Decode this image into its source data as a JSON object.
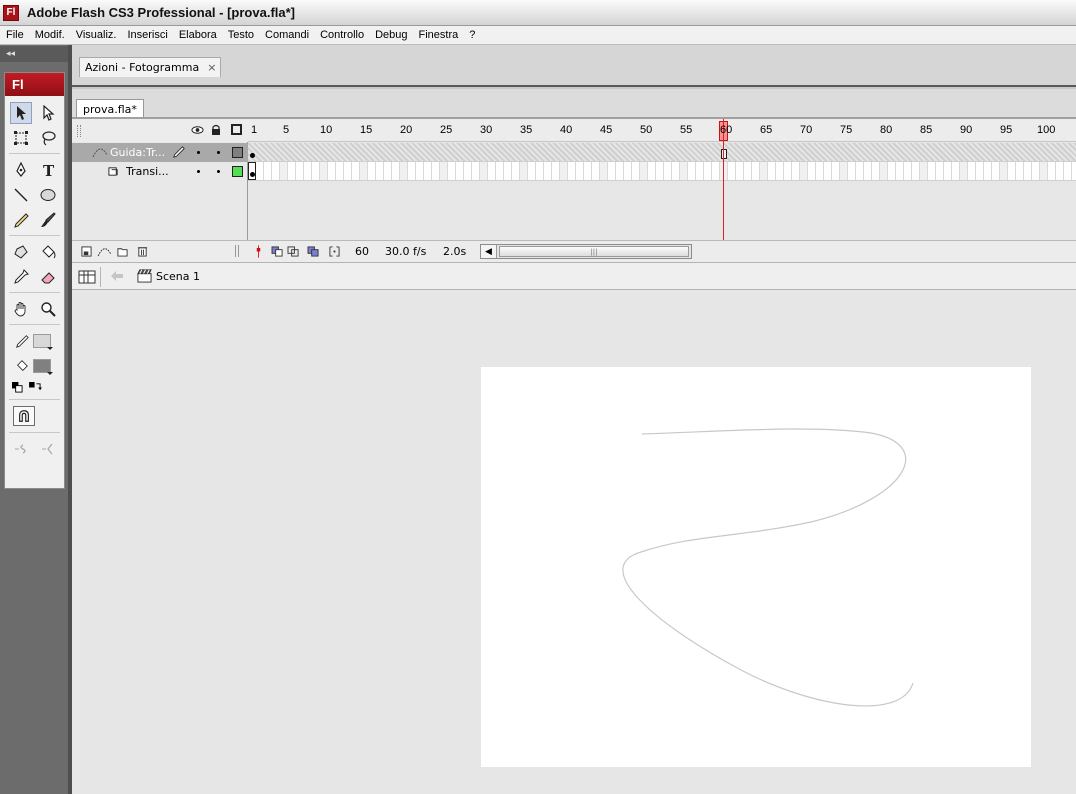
{
  "window": {
    "app_icon": "Fl",
    "title": "Adobe Flash CS3 Professional - [prova.fla*]"
  },
  "menu": [
    "File",
    "Modif.",
    "Visualiz.",
    "Inserisci",
    "Elabora",
    "Testo",
    "Comandi",
    "Controllo",
    "Debug",
    "Finestra",
    "?"
  ],
  "left_panel": {
    "collapse_glyph": "◂◂",
    "logo": "Fl"
  },
  "actions_panel": {
    "tab_label": "Azioni - Fotogramma",
    "close_glyph": "×"
  },
  "document": {
    "tab_label": "prova.fla*"
  },
  "timeline": {
    "frame_numbers": [
      "1",
      "5",
      "10",
      "15",
      "20",
      "25",
      "30",
      "35",
      "40",
      "45",
      "50",
      "55",
      "60",
      "65",
      "70",
      "75",
      "80",
      "85",
      "90",
      "95",
      "100"
    ],
    "current_frame_marker": "60",
    "layers": [
      {
        "name": "Guida:Tr...",
        "type": "guide",
        "selected": true,
        "color": "#808080"
      },
      {
        "name": "Transi...",
        "type": "guided",
        "selected": false,
        "color": "#55dd55"
      }
    ],
    "footer": {
      "current_frame": "60",
      "frame_rate": "30.0 f/s",
      "elapsed_time": "2.0s",
      "scroll_grip": "|||"
    }
  },
  "editbar": {
    "scene_label": "Scena 1"
  },
  "colors": {
    "accent": "#a8121a",
    "playhead": "#e0201e",
    "stage": "#ffffff",
    "motion_guide": "#c8c8c8"
  }
}
